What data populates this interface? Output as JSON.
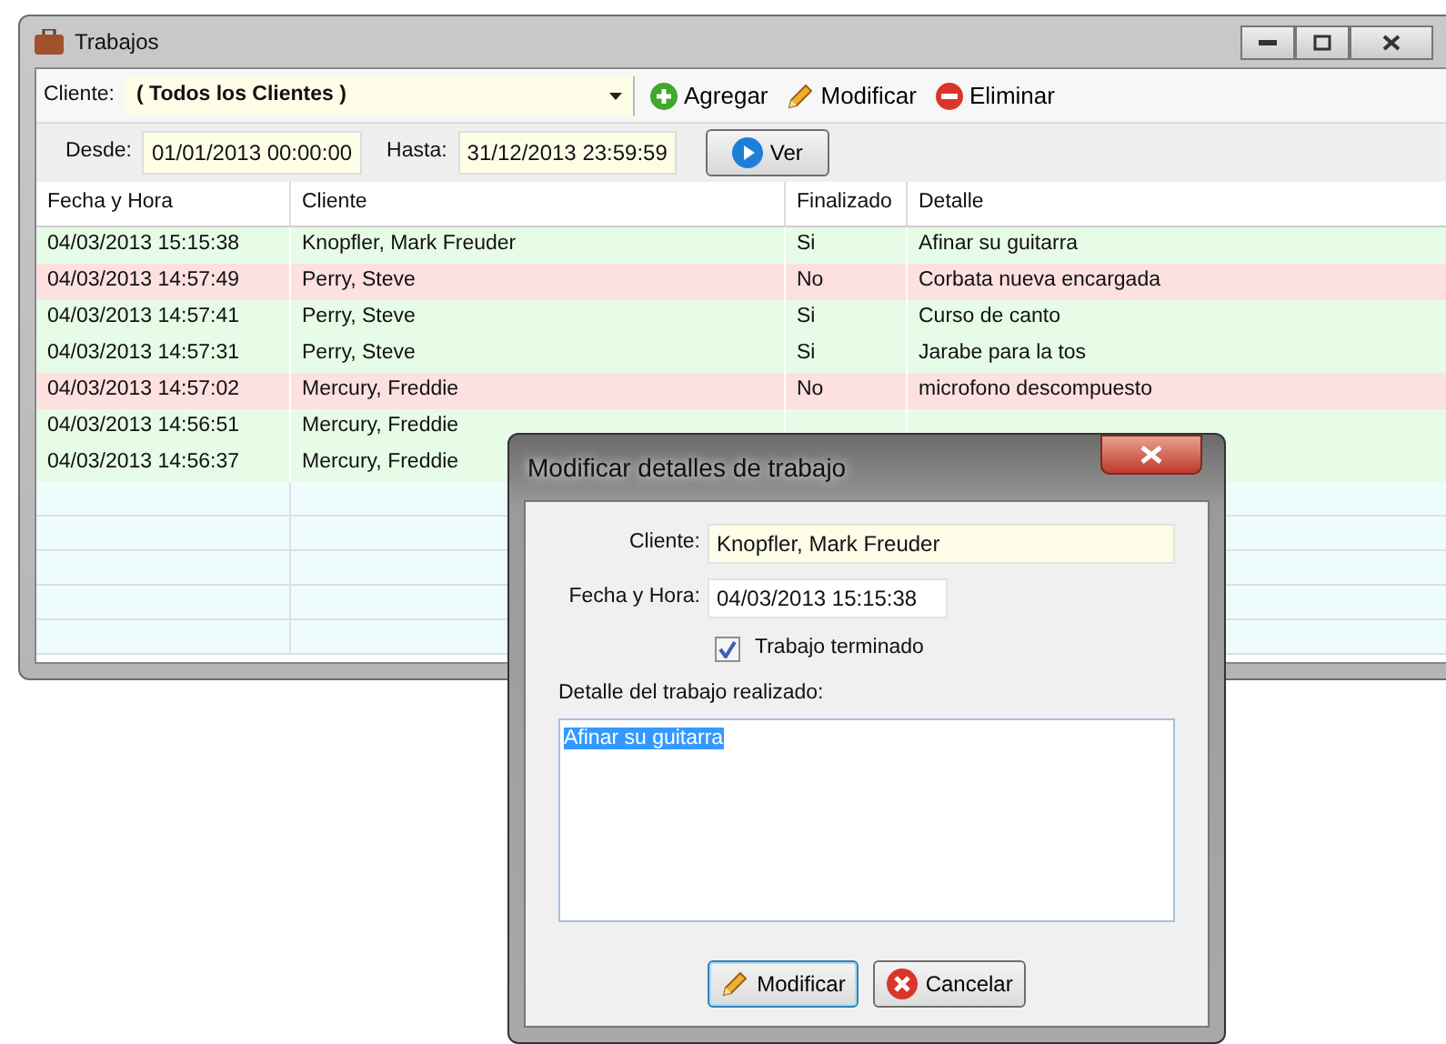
{
  "window": {
    "title": "Trabajos"
  },
  "toolbar": {
    "client_label": "Cliente:",
    "client_value": "( Todos los Clientes )",
    "buttons": [
      {
        "kind": "add",
        "label": "Agregar"
      },
      {
        "kind": "edit",
        "label": "Modificar"
      },
      {
        "kind": "delete",
        "label": "Eliminar"
      }
    ]
  },
  "filter": {
    "from_label": "Desde:",
    "from_value": "01/01/2013 00:00:00",
    "to_label": "Hasta:",
    "to_value": "31/12/2013 23:59:59",
    "button": "Ver"
  },
  "table": {
    "columns": [
      "Fecha y Hora",
      "Cliente",
      "Finalizado",
      "Detalle"
    ],
    "rows": [
      {
        "fecha": "04/03/2013 15:15:38",
        "cliente": "Knopfler, Mark Freuder",
        "finalizado": "Si",
        "detalle": "Afinar su guitarra",
        "done": true
      },
      {
        "fecha": "04/03/2013 14:57:49",
        "cliente": "Perry, Steve",
        "finalizado": "No",
        "detalle": "Corbata nueva encargada",
        "done": false
      },
      {
        "fecha": "04/03/2013 14:57:41",
        "cliente": "Perry, Steve",
        "finalizado": "Si",
        "detalle": "Curso de canto",
        "done": true
      },
      {
        "fecha": "04/03/2013 14:57:31",
        "cliente": "Perry, Steve",
        "finalizado": "Si",
        "detalle": "Jarabe para la tos",
        "done": true
      },
      {
        "fecha": "04/03/2013 14:57:02",
        "cliente": "Mercury, Freddie",
        "finalizado": "No",
        "detalle": "microfono descompuesto",
        "done": false
      },
      {
        "fecha": "04/03/2013 14:56:51",
        "cliente": "Mercury, Freddie",
        "done": true
      },
      {
        "fecha": "04/03/2013 14:56:37",
        "cliente": "Mercury, Freddie",
        "done": true
      }
    ]
  },
  "dialog": {
    "title": "Modificar detalles de trabajo",
    "client_label": "Cliente:",
    "client_value": "Knopfler, Mark Freuder",
    "date_label": "Fecha y Hora:",
    "date_value": "04/03/2013 15:15:38",
    "checkbox": {
      "label": "Trabajo terminado",
      "checked": true
    },
    "detail_label": "Detalle del trabajo realizado:",
    "detail_value": "Afinar su guitarra",
    "buttons": [
      {
        "kind": "edit",
        "label": "Modificar",
        "focused": true
      },
      {
        "kind": "cancel",
        "label": "Cancelar",
        "focused": false
      }
    ]
  }
}
